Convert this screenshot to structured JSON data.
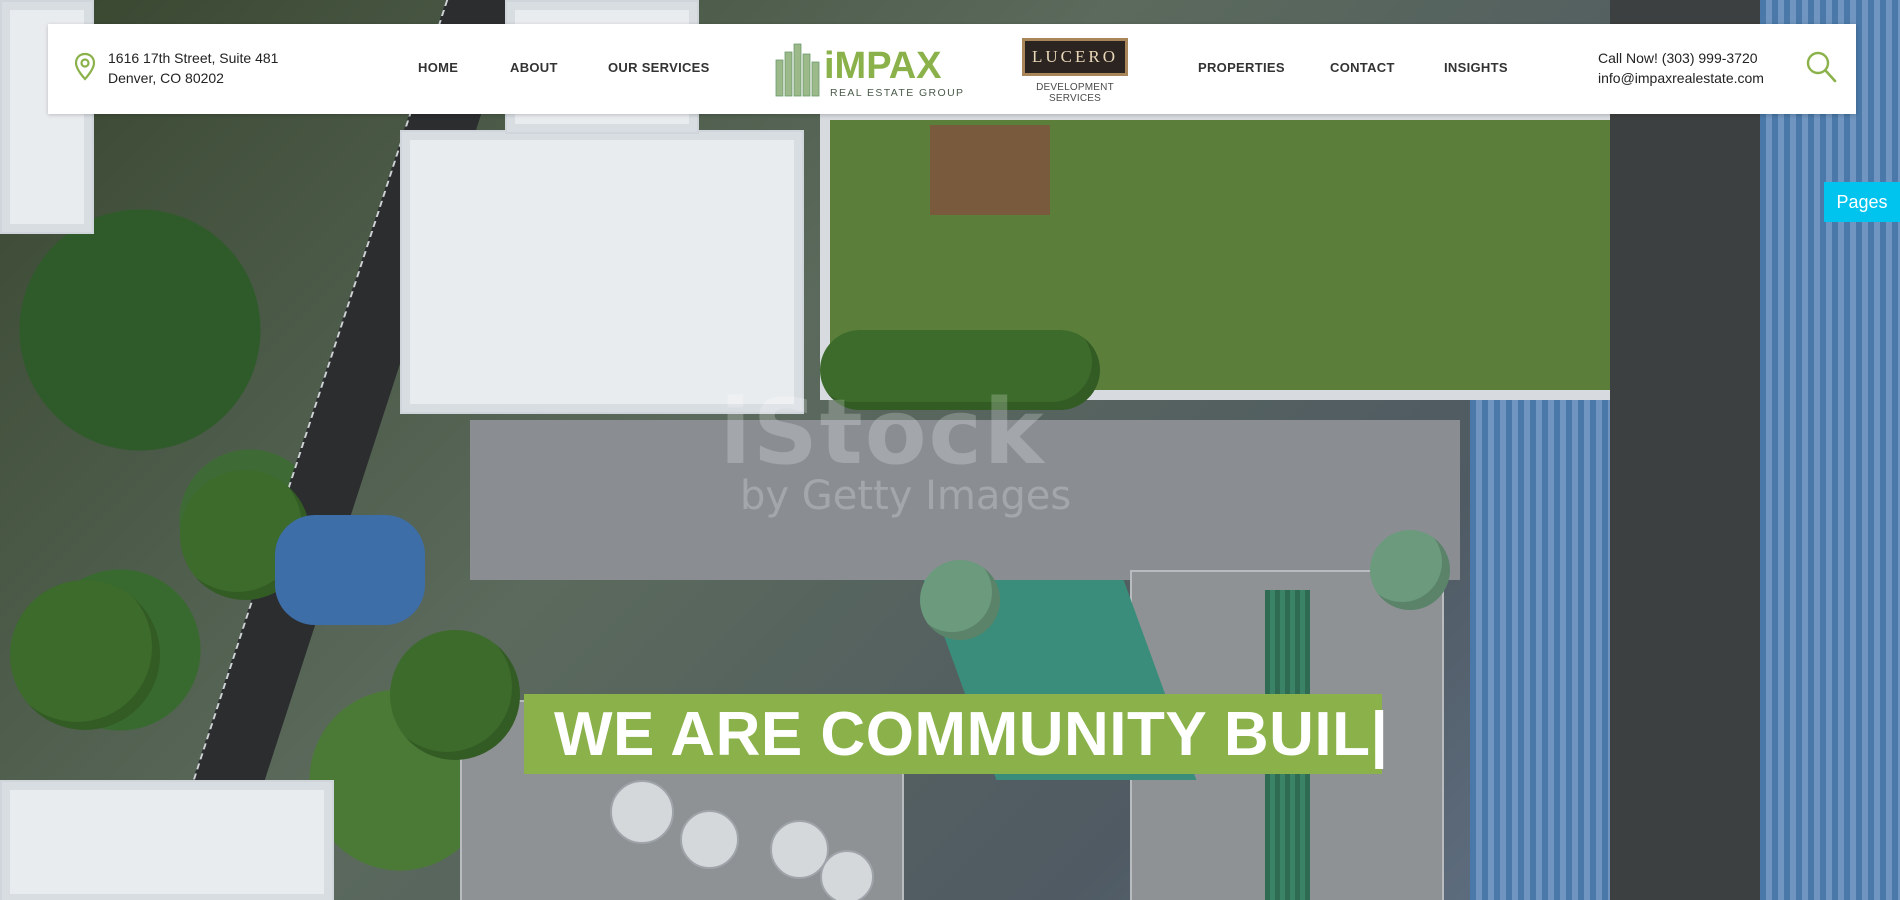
{
  "header": {
    "address": {
      "line1": "1616 17th Street, Suite 481",
      "line2": "Denver, CO 80202",
      "icon": "location-pin-icon"
    },
    "nav_left": [
      {
        "label": "HOME"
      },
      {
        "label": "ABOUT"
      },
      {
        "label": "OUR SERVICES"
      }
    ],
    "nav_right": [
      {
        "label": "PROPERTIES"
      },
      {
        "label": "CONTACT"
      },
      {
        "label": "INSIGHTS"
      }
    ],
    "logo_impax": {
      "name": "iMPAX",
      "tagline": "REAL ESTATE GROUP"
    },
    "logo_lucero": {
      "name": "LUCERO",
      "tagline": "DEVELOPMENT SERVICES"
    },
    "contact": {
      "phone_line": "Call Now! (303) 999-3720",
      "email": "info@impaxrealestate.com"
    },
    "search_icon": "search-icon"
  },
  "side_tab": {
    "label": "Pages"
  },
  "hero": {
    "headline": "WE ARE COMMUNITY BUIL|",
    "watermark_line1": "iStock",
    "watermark_line2": "by Getty Images"
  },
  "colors": {
    "brand_green": "#8bb24a",
    "accent_cyan": "#00c3ee",
    "lucero_dark": "#2b2420",
    "lucero_gold": "#a9865a"
  }
}
